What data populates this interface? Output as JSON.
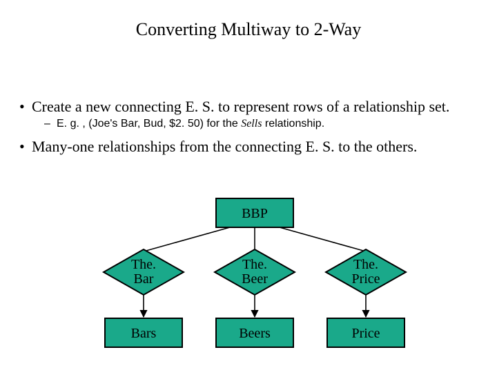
{
  "title": "Converting Multiway to 2-Way",
  "bullets": {
    "b1a": "Create a new connecting E. S. to represent rows of a relationship set.",
    "b2a_prefix": "E. g. , (Joe's Bar, Bud, $2. 50) for the ",
    "b2a_em": "Sells",
    "b2a_suffix": " relationship.",
    "b1b": "Many-one relationships from the connecting E. S.  to the others."
  },
  "diagram": {
    "top_entity": "BBP",
    "rels": {
      "left": {
        "l1": "The.",
        "l2": "Bar"
      },
      "mid": {
        "l1": "The.",
        "l2": "Beer"
      },
      "right": {
        "l1": "The.",
        "l2": "Price"
      }
    },
    "entities": {
      "left": "Bars",
      "mid": "Beers",
      "right": "Price"
    }
  }
}
